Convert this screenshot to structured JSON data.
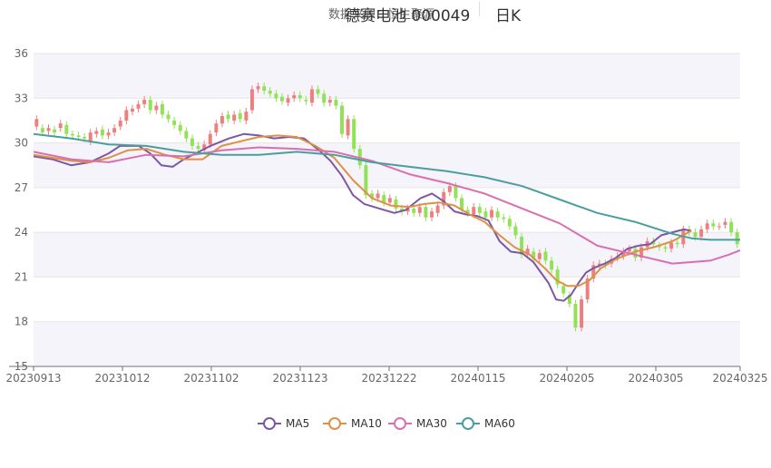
{
  "header": {
    "source": "数据来源：恒生聚源",
    "title": "德赛电池 000049",
    "period": "日K"
  },
  "colors": {
    "up": "#ef7f7f",
    "down": "#91e254",
    "ma5": "#7b58a6",
    "ma10": "#de9146",
    "ma30": "#d96fb0",
    "ma60": "#4b9ea0",
    "band": "#f4f4fa",
    "grid": "#e6e6e6"
  },
  "chart_data": {
    "type": "candlestick",
    "title": "德赛电池 000049",
    "ylim": [
      15,
      36
    ],
    "yticks": [
      15,
      18,
      21,
      24,
      27,
      30,
      33,
      36
    ],
    "xticks": [
      "20230913",
      "20231012",
      "20231102",
      "20231123",
      "20231222",
      "20240115",
      "20240205",
      "20240305",
      "20240325"
    ],
    "legend": [
      "MA5",
      "MA10",
      "MA30",
      "MA60"
    ],
    "legend_position": "bottom",
    "candles_approx": [
      [
        31.1,
        31.6
      ],
      [
        31.0,
        30.7
      ],
      [
        30.8,
        31.0
      ],
      [
        30.9,
        30.7
      ],
      [
        31.0,
        31.3
      ],
      [
        31.2,
        30.6
      ],
      [
        30.6,
        30.5
      ],
      [
        30.5,
        30.4
      ],
      [
        30.4,
        30.3
      ],
      [
        30.1,
        30.7
      ],
      [
        30.6,
        30.8
      ],
      [
        30.9,
        30.5
      ],
      [
        30.5,
        30.7
      ],
      [
        30.7,
        31.0
      ],
      [
        31.1,
        31.5
      ],
      [
        31.5,
        32.2
      ],
      [
        32.1,
        32.3
      ],
      [
        32.3,
        32.6
      ],
      [
        32.6,
        32.9
      ],
      [
        32.9,
        32.2
      ],
      [
        32.2,
        32.5
      ],
      [
        32.6,
        31.9
      ],
      [
        31.9,
        31.6
      ],
      [
        31.5,
        31.2
      ],
      [
        31.2,
        30.8
      ],
      [
        30.8,
        30.3
      ],
      [
        30.3,
        29.8
      ],
      [
        29.8,
        29.6
      ],
      [
        29.5,
        29.9
      ],
      [
        29.9,
        30.6
      ],
      [
        30.7,
        31.3
      ],
      [
        31.3,
        31.8
      ],
      [
        31.9,
        31.6
      ],
      [
        31.5,
        31.9
      ],
      [
        32.0,
        31.6
      ],
      [
        31.5,
        32.1
      ],
      [
        32.2,
        33.6
      ],
      [
        33.6,
        33.8
      ],
      [
        33.8,
        33.5
      ],
      [
        33.5,
        33.3
      ],
      [
        33.3,
        33.0
      ],
      [
        33.1,
        32.8
      ],
      [
        32.7,
        33.0
      ],
      [
        33.0,
        33.2
      ],
      [
        33.2,
        33.0
      ],
      [
        32.9,
        32.8
      ],
      [
        32.7,
        33.6
      ],
      [
        33.6,
        33.3
      ],
      [
        33.3,
        32.7
      ],
      [
        32.7,
        32.9
      ],
      [
        32.9,
        32.5
      ],
      [
        32.5,
        30.6
      ],
      [
        30.5,
        31.6
      ],
      [
        31.6,
        29.6
      ],
      [
        29.6,
        28.5
      ],
      [
        28.5,
        26.5
      ],
      [
        26.6,
        26.3
      ],
      [
        26.3,
        26.6
      ],
      [
        26.5,
        26.0
      ],
      [
        26.0,
        26.3
      ],
      [
        26.2,
        25.6
      ],
      [
        25.6,
        25.4
      ],
      [
        25.4,
        25.6
      ],
      [
        25.6,
        25.3
      ],
      [
        25.3,
        25.7
      ],
      [
        25.7,
        25.0
      ],
      [
        25.0,
        25.4
      ],
      [
        25.3,
        25.8
      ],
      [
        25.8,
        26.7
      ],
      [
        26.7,
        27.1
      ],
      [
        27.1,
        26.3
      ],
      [
        26.3,
        25.5
      ],
      [
        25.5,
        25.3
      ],
      [
        25.2,
        25.7
      ],
      [
        25.7,
        25.3
      ],
      [
        25.4,
        25.0
      ],
      [
        25.0,
        25.5
      ],
      [
        25.4,
        25.0
      ],
      [
        25.0,
        24.9
      ],
      [
        24.9,
        24.4
      ],
      [
        24.4,
        23.8
      ],
      [
        23.7,
        22.5
      ],
      [
        22.5,
        22.9
      ],
      [
        22.7,
        22.2
      ],
      [
        22.2,
        22.6
      ],
      [
        22.7,
        22.1
      ],
      [
        22.1,
        21.5
      ],
      [
        21.5,
        20.5
      ],
      [
        20.4,
        19.9
      ],
      [
        19.8,
        19.2
      ],
      [
        19.2,
        17.6
      ],
      [
        17.6,
        19.5
      ],
      [
        19.5,
        20.9
      ],
      [
        20.9,
        21.8
      ],
      [
        21.8,
        21.9
      ],
      [
        21.9,
        21.8
      ],
      [
        21.9,
        22.2
      ],
      [
        22.3,
        22.4
      ],
      [
        22.4,
        22.7
      ],
      [
        22.7,
        22.9
      ],
      [
        22.9,
        22.3
      ],
      [
        22.3,
        23.0
      ],
      [
        23.0,
        23.4
      ],
      [
        23.4,
        23.2
      ],
      [
        23.1,
        23.0
      ],
      [
        23.0,
        22.9
      ],
      [
        22.9,
        23.3
      ],
      [
        23.3,
        23.2
      ],
      [
        23.2,
        24.2
      ],
      [
        24.2,
        24.0
      ],
      [
        24.0,
        23.7
      ],
      [
        23.7,
        24.2
      ],
      [
        24.2,
        24.6
      ],
      [
        24.6,
        24.4
      ],
      [
        24.4,
        24.4
      ],
      [
        24.5,
        24.7
      ],
      [
        24.7,
        24.0
      ],
      [
        24.0,
        23.2
      ]
    ],
    "series": [
      {
        "name": "MA5",
        "points": [
          [
            0,
            29.1
          ],
          [
            5,
            28.9
          ],
          [
            10,
            28.5
          ],
          [
            15,
            28.7
          ],
          [
            20,
            29.3
          ],
          [
            23,
            29.8
          ],
          [
            28,
            29.8
          ],
          [
            31,
            29.3
          ],
          [
            34,
            28.5
          ],
          [
            37,
            28.4
          ],
          [
            40,
            28.9
          ],
          [
            44,
            29.4
          ],
          [
            47,
            29.8
          ],
          [
            52,
            30.3
          ],
          [
            56,
            30.6
          ],
          [
            60,
            30.5
          ],
          [
            64,
            30.3
          ],
          [
            68,
            30.4
          ],
          [
            72,
            30.3
          ],
          [
            76,
            29.5
          ],
          [
            79,
            28.8
          ],
          [
            82,
            27.8
          ],
          [
            85,
            26.5
          ],
          [
            88,
            25.9
          ],
          [
            92,
            25.6
          ],
          [
            96,
            25.3
          ],
          [
            99,
            25.5
          ],
          [
            103,
            26.3
          ],
          [
            106,
            26.6
          ],
          [
            109,
            26.1
          ],
          [
            112,
            25.4
          ],
          [
            115,
            25.2
          ],
          [
            118,
            25.1
          ],
          [
            121,
            24.8
          ],
          [
            124,
            23.4
          ],
          [
            127,
            22.7
          ],
          [
            130,
            22.6
          ],
          [
            133,
            22.0
          ],
          [
            135,
            21.3
          ],
          [
            137,
            20.6
          ],
          [
            139,
            19.5
          ],
          [
            141,
            19.4
          ],
          [
            143,
            19.8
          ],
          [
            145,
            20.6
          ],
          [
            147,
            21.3
          ],
          [
            149,
            21.6
          ],
          [
            152,
            21.9
          ],
          [
            155,
            22.3
          ],
          [
            158,
            22.9
          ],
          [
            161,
            23.1
          ],
          [
            164,
            23.2
          ],
          [
            167,
            23.8
          ],
          [
            170,
            24.0
          ],
          [
            173,
            24.2
          ],
          [
            175,
            24.1
          ]
        ]
      },
      {
        "name": "MA10",
        "points": [
          [
            0,
            29.2
          ],
          [
            5,
            29.0
          ],
          [
            10,
            28.8
          ],
          [
            15,
            28.7
          ],
          [
            20,
            29.0
          ],
          [
            25,
            29.5
          ],
          [
            30,
            29.6
          ],
          [
            35,
            29.2
          ],
          [
            40,
            28.9
          ],
          [
            45,
            28.9
          ],
          [
            50,
            29.8
          ],
          [
            55,
            30.1
          ],
          [
            60,
            30.4
          ],
          [
            65,
            30.5
          ],
          [
            70,
            30.4
          ],
          [
            75,
            29.8
          ],
          [
            80,
            29.0
          ],
          [
            85,
            27.5
          ],
          [
            90,
            26.3
          ],
          [
            95,
            25.8
          ],
          [
            100,
            25.7
          ],
          [
            104,
            25.9
          ],
          [
            108,
            26.0
          ],
          [
            112,
            25.8
          ],
          [
            116,
            25.2
          ],
          [
            120,
            24.7
          ],
          [
            124,
            23.8
          ],
          [
            128,
            23.0
          ],
          [
            132,
            22.5
          ],
          [
            136,
            21.6
          ],
          [
            139,
            20.8
          ],
          [
            142,
            20.4
          ],
          [
            145,
            20.4
          ],
          [
            148,
            20.8
          ],
          [
            151,
            21.6
          ],
          [
            155,
            22.2
          ],
          [
            160,
            22.7
          ],
          [
            165,
            23.0
          ],
          [
            170,
            23.4
          ],
          [
            175,
            24.1
          ]
        ]
      },
      {
        "name": "MA30",
        "points": [
          [
            0,
            29.4
          ],
          [
            10,
            28.9
          ],
          [
            20,
            28.7
          ],
          [
            30,
            29.2
          ],
          [
            40,
            29.1
          ],
          [
            50,
            29.5
          ],
          [
            60,
            29.7
          ],
          [
            70,
            29.6
          ],
          [
            80,
            29.4
          ],
          [
            90,
            28.8
          ],
          [
            100,
            27.9
          ],
          [
            110,
            27.3
          ],
          [
            120,
            26.6
          ],
          [
            130,
            25.6
          ],
          [
            140,
            24.6
          ],
          [
            150,
            23.1
          ],
          [
            160,
            22.5
          ],
          [
            170,
            21.9
          ],
          [
            175,
            22.0
          ],
          [
            180,
            22.1
          ],
          [
            185,
            22.5
          ],
          [
            188,
            22.8
          ]
        ]
      },
      {
        "name": "MA60",
        "points": [
          [
            0,
            30.6
          ],
          [
            10,
            30.3
          ],
          [
            20,
            29.9
          ],
          [
            30,
            29.8
          ],
          [
            40,
            29.4
          ],
          [
            50,
            29.2
          ],
          [
            60,
            29.2
          ],
          [
            70,
            29.4
          ],
          [
            80,
            29.2
          ],
          [
            90,
            28.7
          ],
          [
            100,
            28.4
          ],
          [
            110,
            28.1
          ],
          [
            120,
            27.7
          ],
          [
            130,
            27.1
          ],
          [
            140,
            26.2
          ],
          [
            150,
            25.3
          ],
          [
            160,
            24.7
          ],
          [
            170,
            23.9
          ],
          [
            175,
            23.6
          ],
          [
            180,
            23.5
          ],
          [
            188,
            23.5
          ]
        ]
      }
    ]
  }
}
